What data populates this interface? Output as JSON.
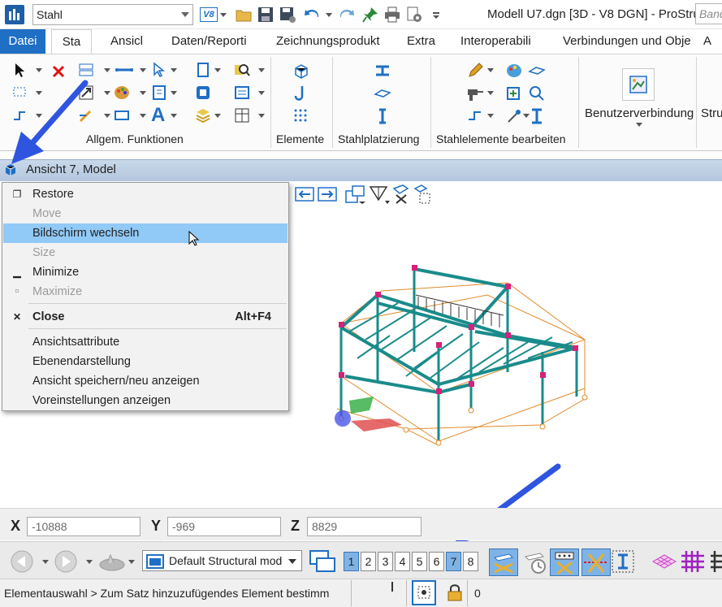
{
  "titlebar": {
    "workset": "Stahl",
    "v8_badge": "V8",
    "window_title": "Modell U7.dgn [3D - V8 DGN] - ProStru",
    "search_placeholder": "Band"
  },
  "tabs": [
    {
      "label": "Datei"
    },
    {
      "label": "Sta"
    },
    {
      "label": "Ansicl"
    },
    {
      "label": "Daten/Reporti"
    },
    {
      "label": "Zeichnungsprodukt"
    },
    {
      "label": "Extra"
    },
    {
      "label": "Interoperabili"
    },
    {
      "label": "Verbindungen und Obje"
    },
    {
      "label": "A"
    }
  ],
  "ribbon": {
    "groups": [
      {
        "label": "Allgem. Funktionen"
      },
      {
        "label": "Elemente"
      },
      {
        "label": "Stahlplatzierung"
      },
      {
        "label": "Stahlelemente bearbeiten"
      }
    ],
    "benutzer_label": "Benutzerverbindung",
    "stru_label": "Stru"
  },
  "view": {
    "title": "Ansicht 7, Model"
  },
  "context_menu": {
    "items": [
      {
        "label": "Restore",
        "glyph": "❐",
        "disabled": false
      },
      {
        "label": "Move",
        "glyph": "",
        "disabled": true
      },
      {
        "label": "Bildschirm wechseln",
        "glyph": "",
        "disabled": false,
        "highlighted": true
      },
      {
        "label": "Size",
        "glyph": "",
        "disabled": true
      },
      {
        "label": "Minimize",
        "glyph": "▁",
        "disabled": false
      },
      {
        "label": "Maximize",
        "glyph": "▫",
        "disabled": true
      },
      {
        "label": "Close",
        "glyph": "✕",
        "accelerator": "Alt+F4",
        "bold": true
      },
      {
        "label": "Ansichtsattribute"
      },
      {
        "label": "Ebenendarstellung"
      },
      {
        "label": "Ansicht speichern/neu anzeigen"
      },
      {
        "label": "Voreinstellungen anzeigen"
      }
    ]
  },
  "coords": {
    "x_label": "X",
    "x_value": "-10888",
    "y_label": "Y",
    "y_value": "-969",
    "z_label": "Z",
    "z_value": "8829"
  },
  "bottombar": {
    "model": "Default Structural model",
    "view_buttons": [
      "1",
      "2",
      "3",
      "4",
      "5",
      "6",
      "7",
      "8"
    ],
    "active_views": [
      "1",
      "7"
    ]
  },
  "statusbar": {
    "text": "Elementauswahl > Zum Satz hinzuzufügendes Element bestimm",
    "count": "0"
  },
  "colors": {
    "accent": "#1f6fc5",
    "highlight": "#91c9f7",
    "steel": "#1a8b8b",
    "annotation_arrow": "#2f55e0"
  }
}
